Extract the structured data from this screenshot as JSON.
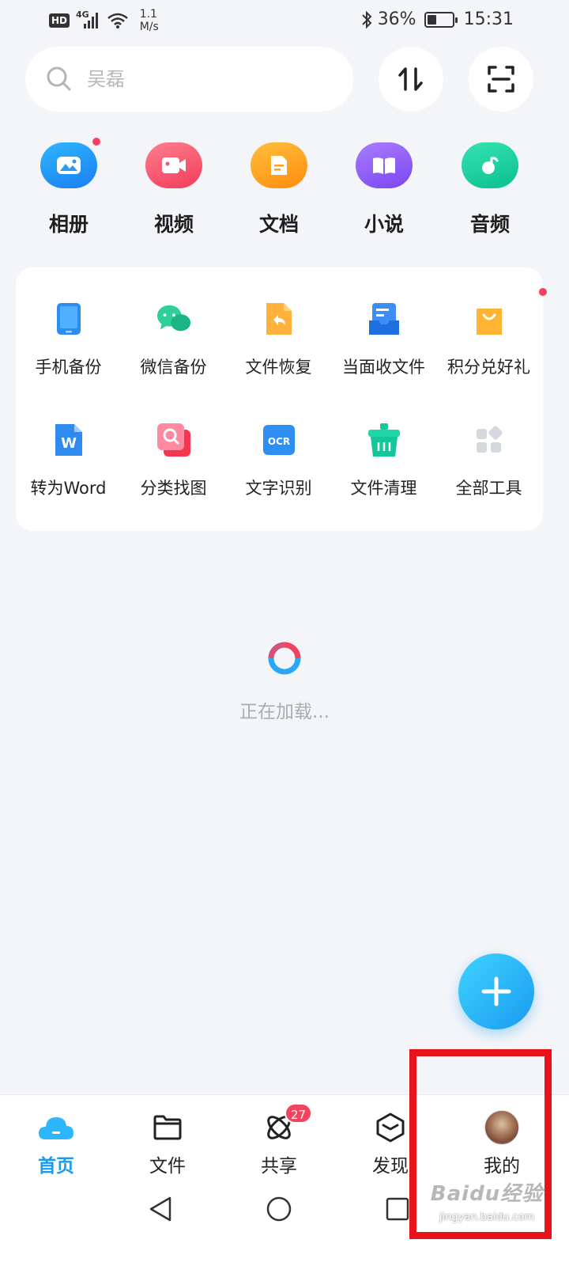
{
  "status": {
    "hd": "HD",
    "network": "4G",
    "speed_value": "1.1",
    "speed_unit": "M/s",
    "battery": "36%",
    "time": "15:31"
  },
  "search": {
    "placeholder": "吴磊"
  },
  "categories": [
    {
      "label": "相册",
      "color": "#1a8cf5",
      "icon": "photo-icon",
      "dot": true
    },
    {
      "label": "视频",
      "color": "#f4566e",
      "icon": "video-icon",
      "dot": false
    },
    {
      "label": "文档",
      "color": "#ff9f1a",
      "icon": "document-icon",
      "dot": false
    },
    {
      "label": "小说",
      "color": "#8a5cf5",
      "icon": "book-icon",
      "dot": false
    },
    {
      "label": "音频",
      "color": "#14cf9e",
      "icon": "music-icon",
      "dot": false
    }
  ],
  "tools": [
    {
      "label": "手机备份",
      "icon": "phone-backup-icon"
    },
    {
      "label": "微信备份",
      "icon": "wechat-backup-icon"
    },
    {
      "label": "文件恢复",
      "icon": "file-restore-icon"
    },
    {
      "label": "当面收文件",
      "icon": "receive-file-icon"
    },
    {
      "label": "积分兑好礼",
      "icon": "gift-bag-icon"
    },
    {
      "label": "转为Word",
      "icon": "word-icon"
    },
    {
      "label": "分类找图",
      "icon": "find-image-icon"
    },
    {
      "label": "文字识别",
      "icon": "ocr-icon"
    },
    {
      "label": "文件清理",
      "icon": "cleanup-icon"
    },
    {
      "label": "全部工具",
      "icon": "all-tools-icon"
    }
  ],
  "ocr_icon_text": "OCR",
  "word_icon_text": "W",
  "loading": {
    "text": "正在加载..."
  },
  "tabs": [
    {
      "label": "首页",
      "icon": "cloud-home-icon",
      "active": true
    },
    {
      "label": "文件",
      "icon": "folder-icon"
    },
    {
      "label": "共享",
      "icon": "share-atom-icon",
      "badge": "27"
    },
    {
      "label": "发现",
      "icon": "discover-box-icon"
    },
    {
      "label": "我的",
      "icon": "avatar"
    }
  ],
  "watermark": {
    "logo": "Baidu经验",
    "url": "jingyan.baidu.com"
  },
  "colors": {
    "accent": "#1a9bf0",
    "highlight": "#e8121b",
    "badge": "#f2445f"
  }
}
